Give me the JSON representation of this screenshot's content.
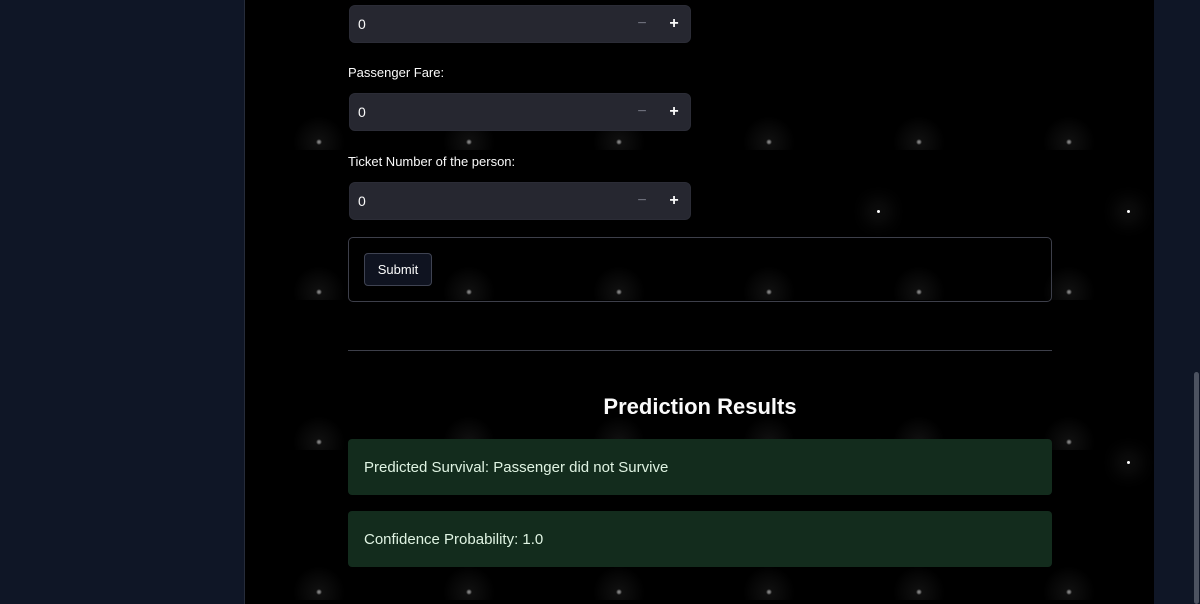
{
  "fields": [
    {
      "label": "",
      "value": "0"
    },
    {
      "label": "Passenger Fare:",
      "value": "0"
    },
    {
      "label": "Ticket Number of the person:",
      "value": "0"
    }
  ],
  "stepper": {
    "minus_symbol": "−",
    "plus_symbol": "+"
  },
  "form": {
    "submit_label": "Submit"
  },
  "results": {
    "title": "Prediction Results",
    "survival_text": "Predicted Survival: Passenger did not Survive",
    "confidence_text": "Confidence Probability: 1.0"
  },
  "colors": {
    "sidebar_bg": "#0f1626",
    "main_bg": "#000000",
    "input_bg": "#262730",
    "success_bg": "#132c1d",
    "success_text": "#dff3e2"
  }
}
